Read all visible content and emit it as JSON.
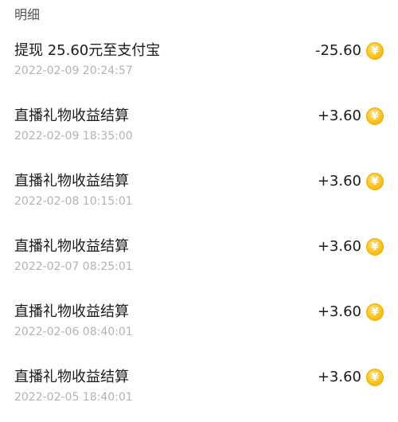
{
  "section": {
    "title": "明细"
  },
  "coin_glyph": "¥",
  "colors": {
    "coin": "#f7c21c",
    "amount": "#1a1a1a",
    "timestamp": "#b3b3b3"
  },
  "transactions": [
    {
      "title": "提现 25.60元至支付宝",
      "time": "2022-02-09 20:24:57",
      "amount": "-25.60",
      "icon": "gold-coin-icon"
    },
    {
      "title": "直播礼物收益结算",
      "time": "2022-02-09 18:35:00",
      "amount": "+3.60",
      "icon": "gold-coin-icon"
    },
    {
      "title": "直播礼物收益结算",
      "time": "2022-02-08 10:15:01",
      "amount": "+3.60",
      "icon": "gold-coin-icon"
    },
    {
      "title": "直播礼物收益结算",
      "time": "2022-02-07 08:25:01",
      "amount": "+3.60",
      "icon": "gold-coin-icon"
    },
    {
      "title": "直播礼物收益结算",
      "time": "2022-02-06 08:40:01",
      "amount": "+3.60",
      "icon": "gold-coin-icon"
    },
    {
      "title": "直播礼物收益结算",
      "time": "2022-02-05 18:40:01",
      "amount": "+3.60",
      "icon": "gold-coin-icon"
    }
  ]
}
